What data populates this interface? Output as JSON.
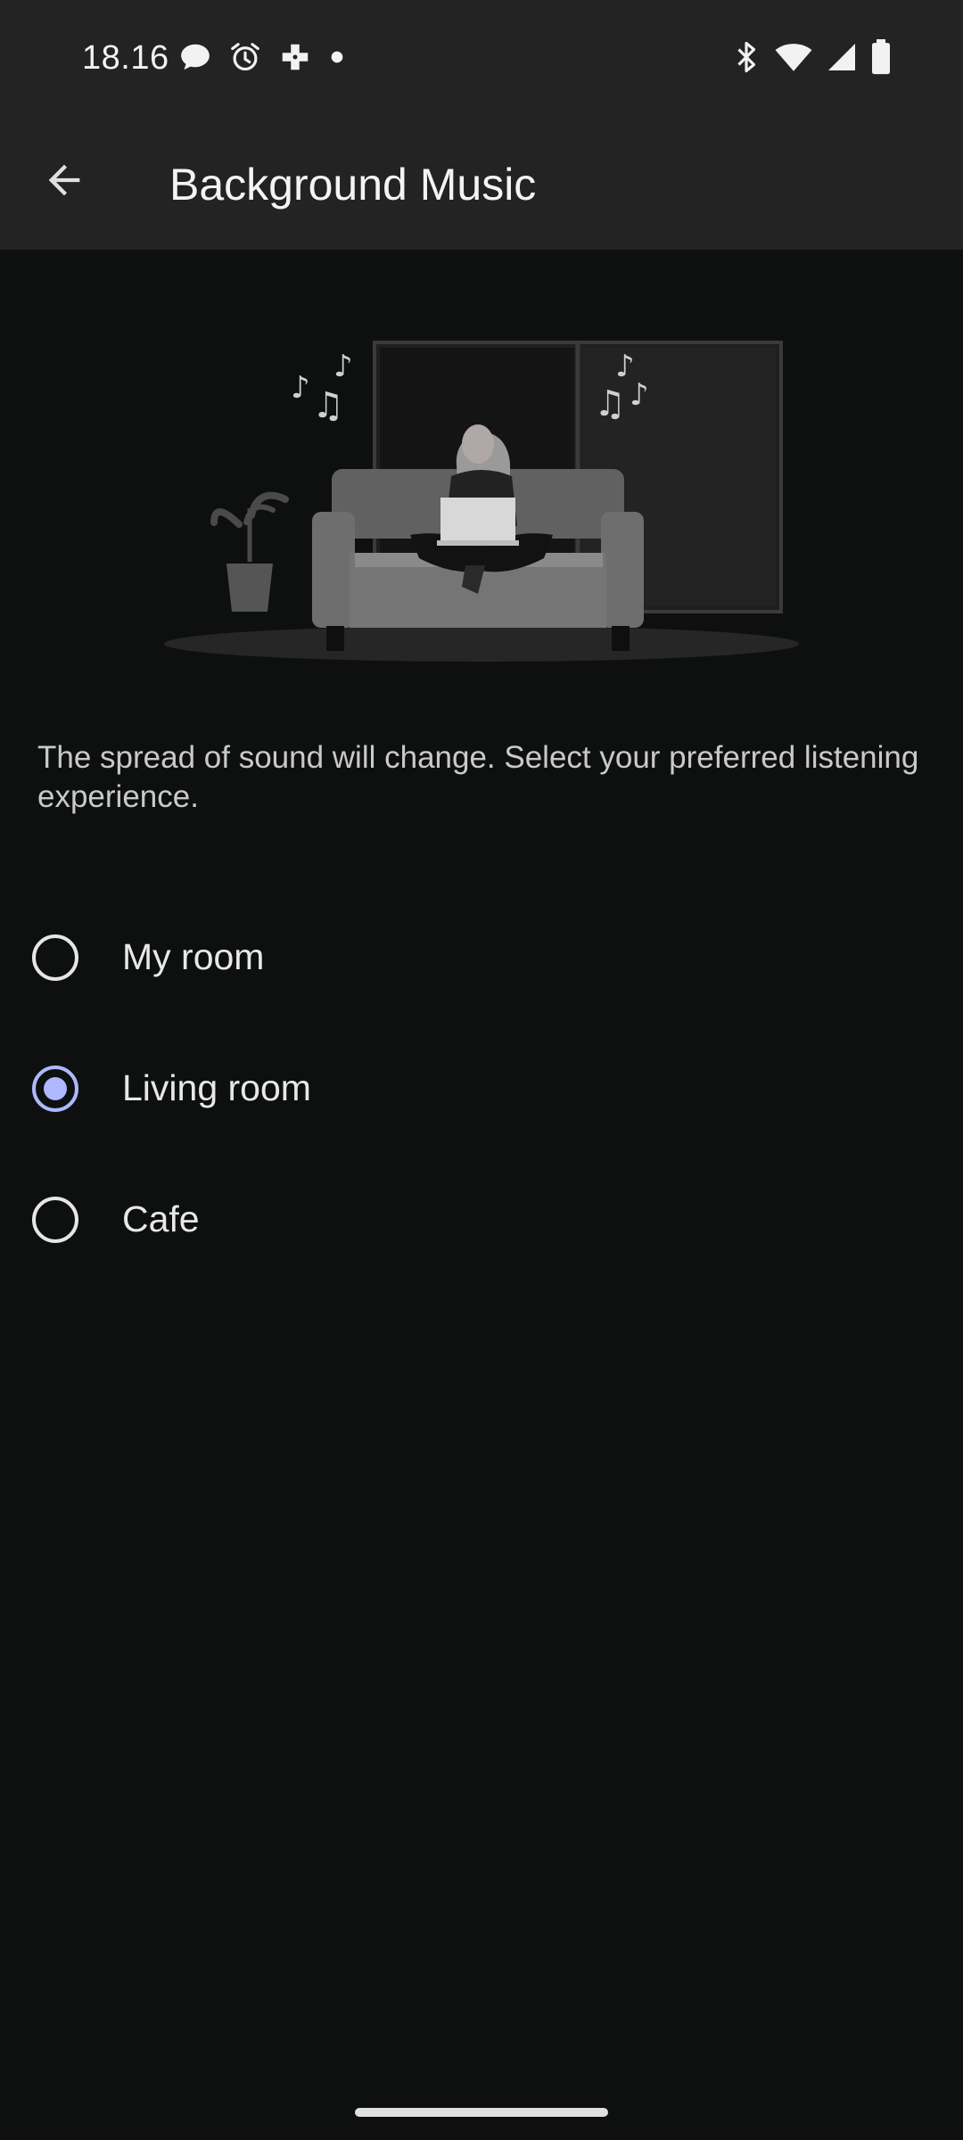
{
  "status_bar": {
    "time": "18.16",
    "icons_left": [
      "chat-bubble-icon",
      "alarm-icon",
      "game-controller-icon",
      "dot-icon"
    ],
    "icons_right": [
      "bluetooth-icon",
      "wifi-icon",
      "signal-icon",
      "battery-icon"
    ]
  },
  "app_bar": {
    "title": "Background Music",
    "back_icon": "arrow-back-icon"
  },
  "description": "The spread of sound will change. Select your preferred listening experience.",
  "options": [
    {
      "label": "My room",
      "selected": false
    },
    {
      "label": "Living room",
      "selected": true
    },
    {
      "label": "Cafe",
      "selected": false
    }
  ],
  "colors": {
    "background": "#0e1010",
    "app_bar": "#232323",
    "accent": "#aeb8ff",
    "text": "#e6e6e6"
  }
}
